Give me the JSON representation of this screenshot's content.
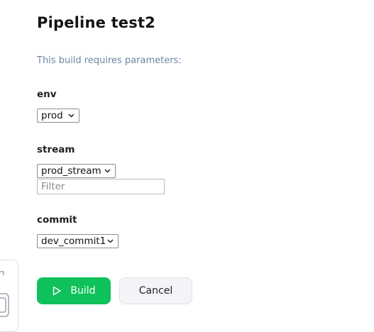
{
  "dialog": {
    "title": "Pipeline test2",
    "subtitle": "This build requires parameters:"
  },
  "params": [
    {
      "label": "env",
      "selected": "prod"
    },
    {
      "label": "stream",
      "selected": "prod_stream",
      "filter_placeholder": "Filter"
    },
    {
      "label": "commit",
      "selected": "dev_commit1"
    }
  ],
  "buttons": {
    "build_label": "Build",
    "cancel_label": "Cancel"
  },
  "colors": {
    "build_bg": "#0fc15a",
    "cancel_bg": "#f2f4f7",
    "subtitle": "#6c86a5"
  },
  "icons": {
    "build": "play-icon",
    "select": "chevron-down-icon"
  }
}
